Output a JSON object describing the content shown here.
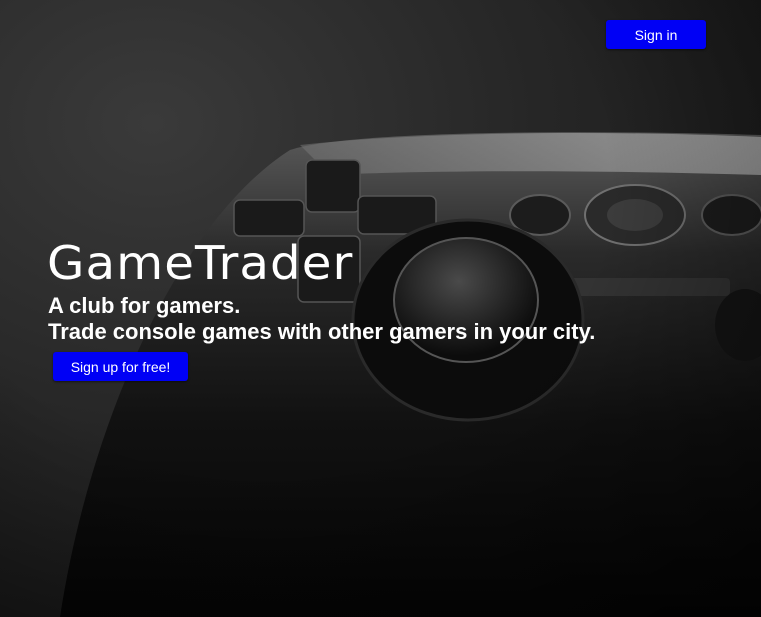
{
  "header": {
    "sign_in_label": "Sign in"
  },
  "hero": {
    "brand": "GameTrader",
    "tagline_line1": "A club for gamers.",
    "tagline_line2": "Trade console games with other gamers in your city.",
    "signup_label": "Sign up for free!"
  },
  "colors": {
    "button": "#0000f5",
    "text": "#ffffff"
  }
}
